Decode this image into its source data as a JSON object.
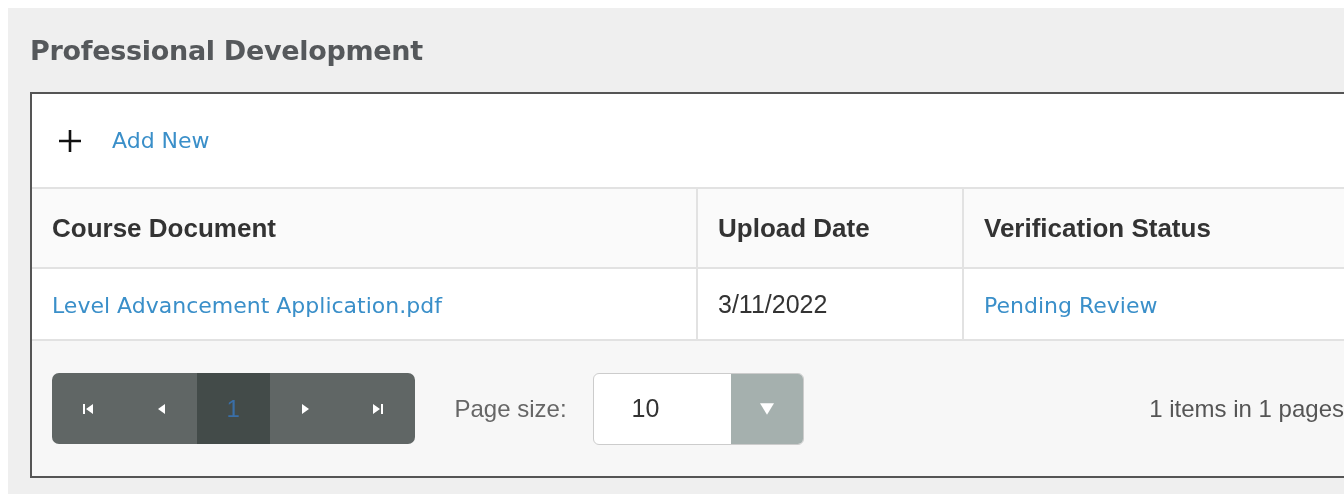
{
  "section": {
    "title": "Professional Development"
  },
  "toolbar": {
    "add_label": "Add New"
  },
  "table": {
    "columns": [
      "Course Document",
      "Upload Date",
      "Verification Status"
    ],
    "rows": [
      {
        "document": "Level Advancement Application.pdf",
        "upload_date": "3/11/2022",
        "status": "Pending Review"
      }
    ]
  },
  "pager": {
    "pages": [
      {
        "label": "1",
        "selected": true
      }
    ],
    "page_size_label": "Page size:",
    "page_size": "10",
    "summary": "1 items in 1 pages"
  }
}
